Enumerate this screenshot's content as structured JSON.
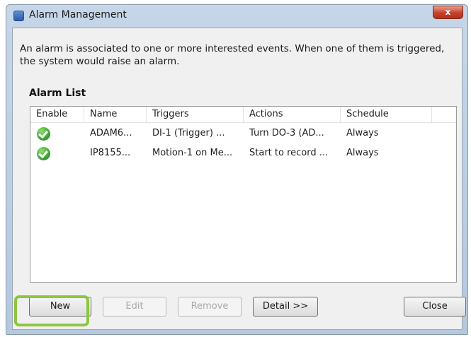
{
  "window": {
    "title": "Alarm Management",
    "close_label": "x"
  },
  "description": "An alarm is associated to one or more interested events. When one of them is triggered, the system would raise an alarm.",
  "alarm_list": {
    "label": "Alarm List",
    "columns": [
      "Enable",
      "Name",
      "Triggers",
      "Actions",
      "Schedule"
    ],
    "rows": [
      {
        "enabled": true,
        "name": "ADAM6...",
        "triggers": "DI-1 (Trigger) ...",
        "actions": "Turn DO-3 (AD...",
        "schedule": "Always"
      },
      {
        "enabled": true,
        "name": "IP8155...",
        "triggers": "Motion-1 on Me...",
        "actions": "Start to record ...",
        "schedule": "Always"
      }
    ]
  },
  "buttons": {
    "new": "New",
    "edit": "Edit",
    "remove": "Remove",
    "detail": "Detail >>",
    "close": "Close"
  },
  "colors": {
    "highlight": "#8cc63f",
    "enabled_icon": "#2f9a2f"
  }
}
